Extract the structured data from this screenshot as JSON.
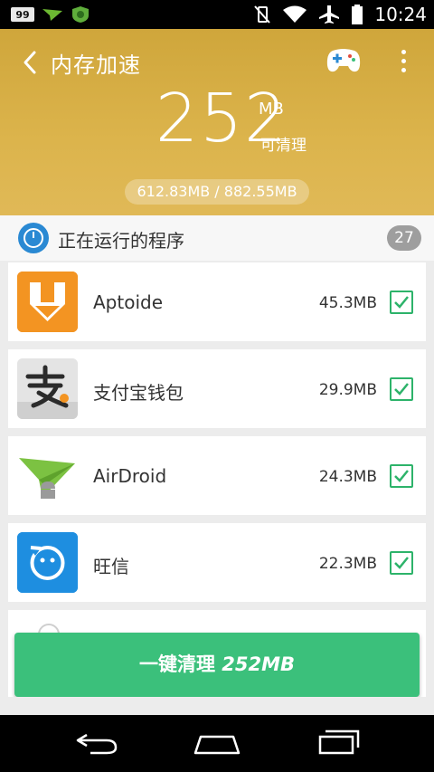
{
  "status_bar": {
    "badge": "99",
    "time": "10:24"
  },
  "header": {
    "title": "内存加速",
    "cleanable_value": "252",
    "cleanable_unit": "MB",
    "cleanable_label": "可清理",
    "memory_usage": "612.83MB / 882.55MB"
  },
  "section": {
    "title": "正在运行的程序",
    "count": "27"
  },
  "apps": [
    {
      "name": "Aptoide",
      "size": "45.3MB",
      "checked": true
    },
    {
      "name": "支付宝钱包",
      "size": "29.9MB",
      "checked": true
    },
    {
      "name": "AirDroid",
      "size": "24.3MB",
      "checked": true
    },
    {
      "name": "旺信",
      "size": "22.3MB",
      "checked": true
    }
  ],
  "clean_button": {
    "label": "一键清理",
    "amount": "252MB"
  },
  "colors": {
    "header": "#d6ad46",
    "accent_green": "#3bc07b",
    "check_green": "#2db36a",
    "section_icon": "#2a89d3"
  }
}
